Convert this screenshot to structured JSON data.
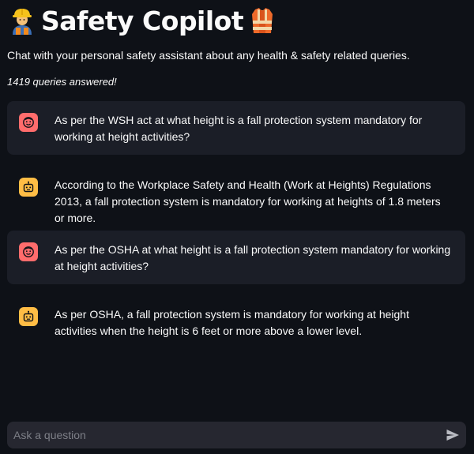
{
  "header": {
    "title": "Safety Copilot",
    "left_icon": "construction-worker-emoji",
    "right_icon": "safety-vest-emoji",
    "subtitle": "Chat with your personal safety assistant about any health & safety related queries.",
    "count_text": "1419 queries answered!"
  },
  "messages": [
    {
      "role": "user",
      "icon": "user-face-icon",
      "text": "As per the WSH act at what height is a fall protection system mandatory for working at height activities?"
    },
    {
      "role": "assistant",
      "icon": "bot-icon",
      "text": "According to the Workplace Safety and Health (Work at Heights) Regulations 2013, a fall protection system is mandatory for working at heights of 1.8 meters or more."
    },
    {
      "role": "user",
      "icon": "user-face-icon",
      "text": "As per the OSHA at what height is a fall protection system mandatory for working at height activities?"
    },
    {
      "role": "assistant",
      "icon": "bot-icon",
      "text": "As per OSHA, a fall protection system is mandatory for working at height activities when the height is 6 feet or more above a lower level."
    }
  ],
  "chat_input": {
    "placeholder": "Ask a question",
    "value": "",
    "send_icon": "send-icon"
  },
  "colors": {
    "background": "#0e1117",
    "user_bubble": "#1b1e27",
    "user_avatar": "#ff6c6c",
    "assistant_avatar": "#ffbd45",
    "input_background": "#262730"
  }
}
